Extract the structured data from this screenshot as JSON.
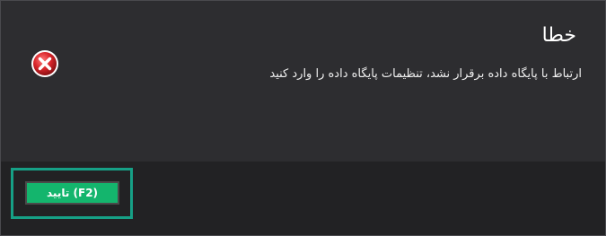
{
  "dialog": {
    "title": "خطا",
    "message": "ارتباط با پایگاه داده برقرار نشد، تنظیمات پایگاه داده را وارد کنید",
    "icon": "error-icon",
    "ok_button_label": "(F2) تایید"
  },
  "colors": {
    "background": "#2d2d30",
    "footer": "#222224",
    "button": "#14b56d",
    "focus_ring": "#16a086",
    "error_red": "#d9262b"
  }
}
